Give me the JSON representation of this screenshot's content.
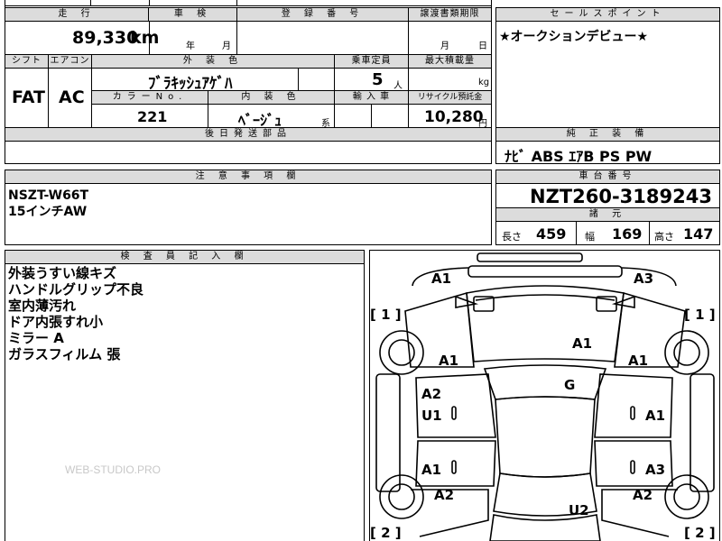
{
  "headers": {
    "mileage": "走 行",
    "inspection": "車 検",
    "registration": "登 録 番 号",
    "transfer_deadline": "譲渡書類期限",
    "sales_point": "セールスポイント",
    "shift": "シフト",
    "aircon": "エアコン",
    "exterior_color": "外 装 色",
    "capacity": "乗車定員",
    "max_load": "最大積載量",
    "color_no": "カラーNo.",
    "interior_color": "内 装 色",
    "import": "輸 入 車",
    "recycle": "リサイクル預託金",
    "later_parts": "後日発送部品",
    "standard_equipment": "純 正 装 備",
    "notes": "注 意 事 項 欄",
    "chassis_no": "車台番号",
    "specs": "諸 元",
    "inspector_notes": "検 査 員 記 入 欄"
  },
  "vehicle": {
    "mileage": "89,330",
    "mileage_unit": "km",
    "inspection_year_unit": "年",
    "inspection_month_unit": "月",
    "transfer_month_unit": "月",
    "transfer_day_unit": "日",
    "shift": "FAT",
    "aircon": "AC",
    "exterior_color": "ﾌﾞﾗｷｯｼｭｱｹﾞﾊ",
    "capacity": "5",
    "capacity_unit": "人",
    "load_unit": "kg",
    "color_no": "221",
    "interior_color": "ﾍﾞｰｼﾞｭ",
    "interior_suffix": "系",
    "recycle_fee": "10,280",
    "recycle_unit": "円",
    "sales_point": "★オークションデビュー★",
    "equipment": "ﾅﾋﾞ ABS ｴｱB PS PW",
    "notes": [
      "NSZT-W66T",
      "15インチAW"
    ],
    "chassis_no": "NZT260-3189243",
    "specs": {
      "length_label": "長さ",
      "length": "459",
      "width_label": "幅",
      "width": "169",
      "height_label": "高さ",
      "height": "147"
    }
  },
  "inspector_notes": [
    "外装うすい線キズ",
    "ハンドルグリップ不良",
    "室内薄汚れ",
    "ドア内張すれ小",
    "ミラー A",
    "ガラスフィルム 張"
  ],
  "diagram": {
    "labels": {
      "front_left_corner": "A1",
      "front_right_corner": "A3",
      "front_left_bracket": "[ 1 ]",
      "front_right_bracket": "[ 1 ]",
      "hood": "A1",
      "left_fender": "A1",
      "right_fender": "A1",
      "windshield": "G",
      "left_front_door_1": "A2",
      "left_front_door_2": "U1",
      "right_front_door": "A1",
      "left_rear_door": "A1",
      "right_rear_door": "A3",
      "left_rear_fender": "A2",
      "right_rear_fender": "A2",
      "trunk": "U2",
      "rear_left_bracket": "[ 2 ]",
      "rear_right_bracket": "[ 2 ]"
    }
  },
  "watermark": "WEB-STUDIO.PRO"
}
